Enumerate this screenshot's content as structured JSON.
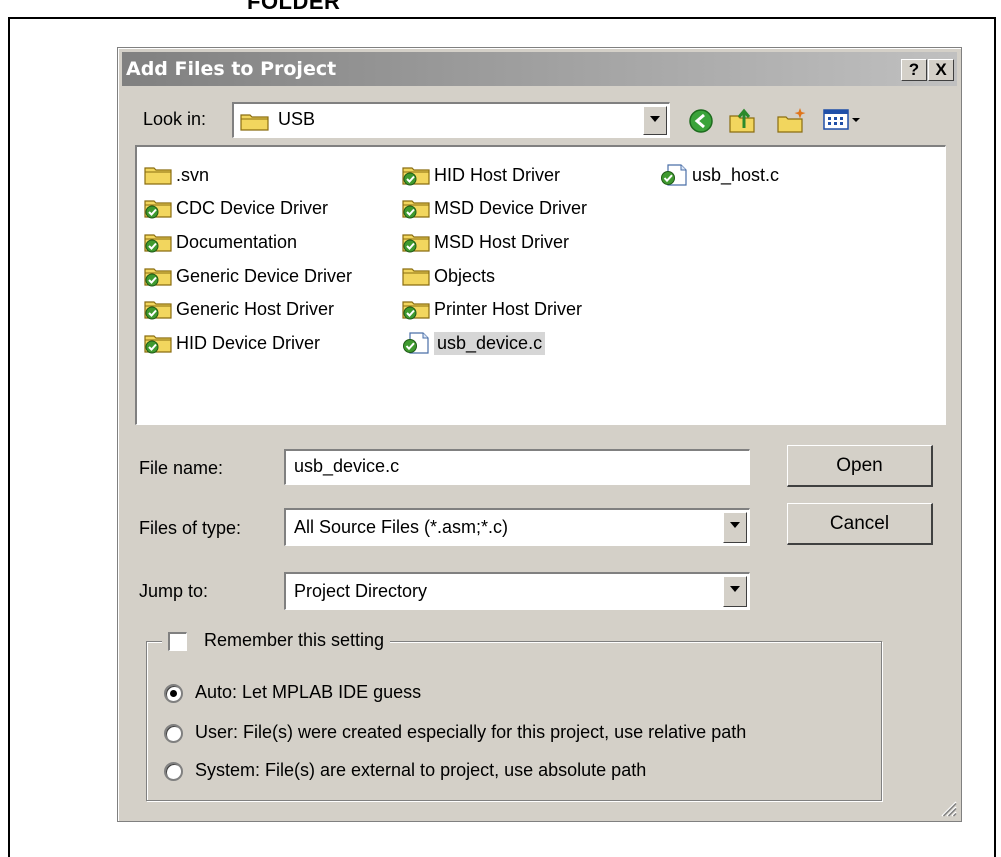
{
  "doc_heading": "FOLDER",
  "dialog": {
    "title": "Add Files to Project",
    "help_glyph": "?",
    "close_glyph": "X"
  },
  "lookin": {
    "label": "Look in:",
    "value": "USB",
    "toolbar_icons": [
      "back-icon",
      "up-folder-icon",
      "new-folder-icon",
      "view-menu-icon"
    ]
  },
  "files": [
    {
      "name": ".svn",
      "kind": "folder-plain"
    },
    {
      "name": "CDC Device Driver",
      "kind": "folder-svn"
    },
    {
      "name": "Documentation",
      "kind": "folder-svn"
    },
    {
      "name": "Generic Device Driver",
      "kind": "folder-svn"
    },
    {
      "name": "Generic Host Driver",
      "kind": "folder-svn"
    },
    {
      "name": "HID Device Driver",
      "kind": "folder-svn"
    },
    {
      "name": "HID Host Driver",
      "kind": "folder-svn"
    },
    {
      "name": "MSD Device Driver",
      "kind": "folder-svn"
    },
    {
      "name": "MSD Host Driver",
      "kind": "folder-svn"
    },
    {
      "name": "Objects",
      "kind": "folder-plain"
    },
    {
      "name": "Printer Host Driver",
      "kind": "folder-svn"
    },
    {
      "name": "usb_device.c",
      "kind": "file-svn",
      "selected": true
    },
    {
      "name": "usb_host.c",
      "kind": "file-svn"
    }
  ],
  "filename": {
    "label": "File name:",
    "value": "usb_device.c"
  },
  "filetype": {
    "label": "Files of type:",
    "value": "All Source Files (*.asm;*.c)"
  },
  "jumpto": {
    "label": "Jump to:",
    "value": "Project Directory"
  },
  "buttons": {
    "open": "Open",
    "cancel": "Cancel"
  },
  "remember": {
    "label": "Remember this setting",
    "checked": false
  },
  "options": [
    {
      "label": "Auto: Let MPLAB IDE guess",
      "selected": true
    },
    {
      "label": "User: File(s) were created especially for this project, use relative path",
      "selected": false
    },
    {
      "label": "System: File(s) are external to project, use absolute path",
      "selected": false
    }
  ],
  "colors": {
    "titlebar_start": "#808080",
    "titlebar_end": "#c0c0c0",
    "dialog_bg": "#d4d0c8",
    "folder_yellow": "#f2d65e",
    "svn_green": "#3f9a2f"
  }
}
